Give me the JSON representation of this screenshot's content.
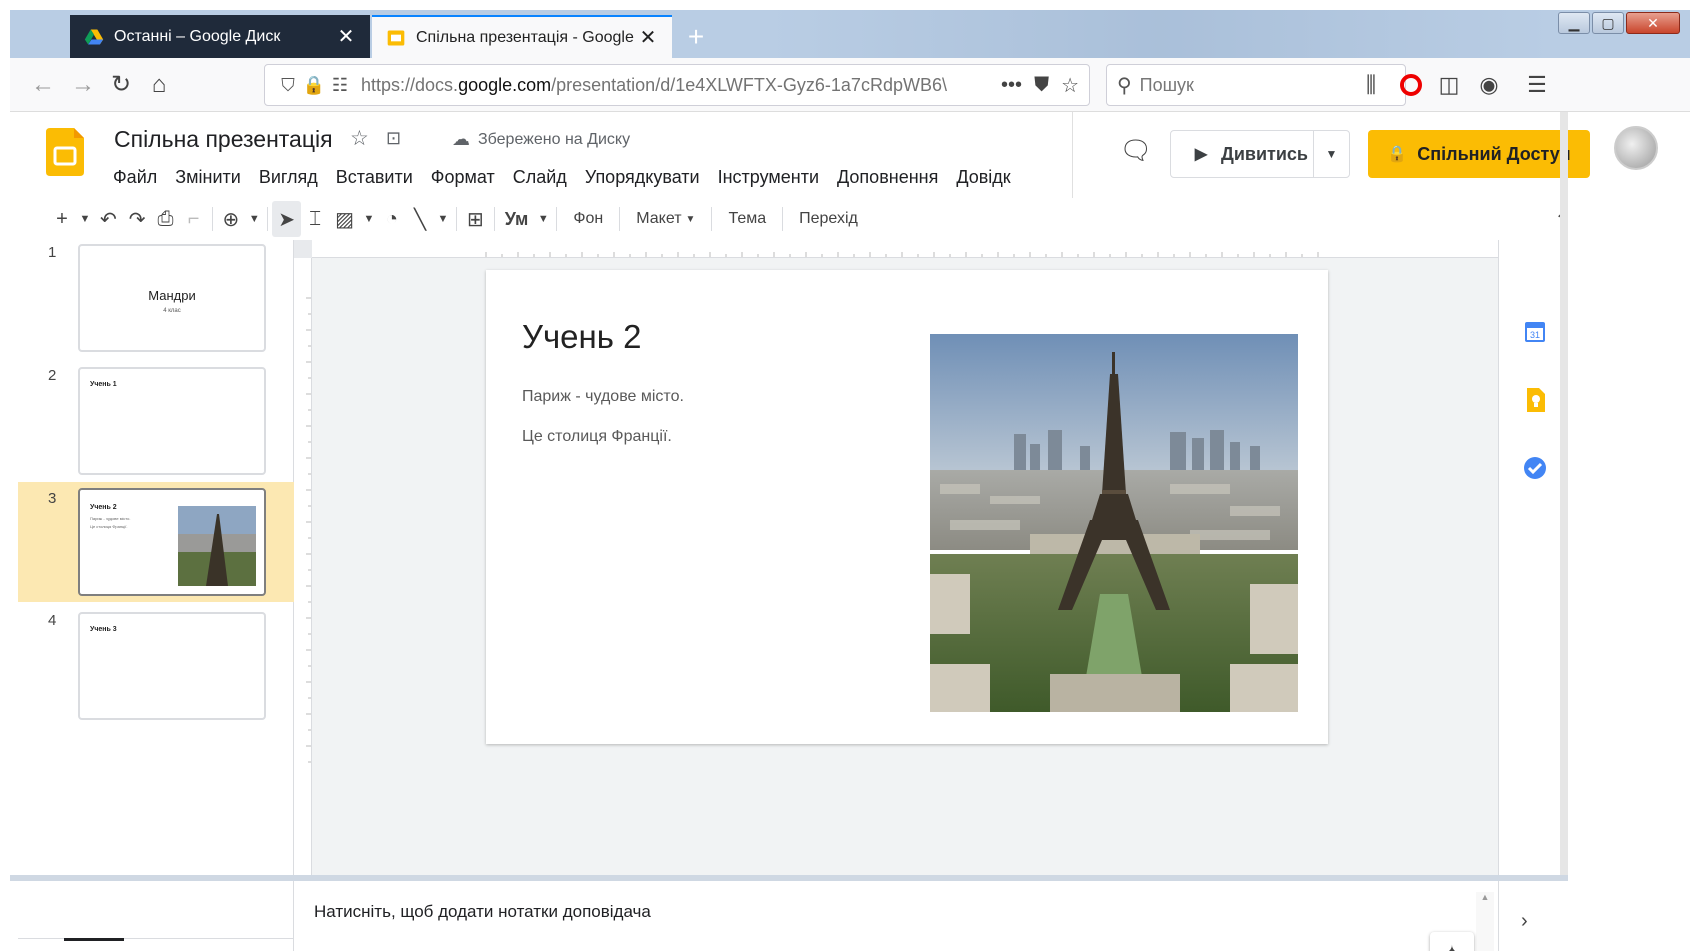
{
  "browser": {
    "tabs": [
      {
        "label": "Останні – Google Диск",
        "active": false
      },
      {
        "label": "Спільна презентація - Google",
        "active": true
      }
    ],
    "url": {
      "prefix": "https://docs.",
      "domain": "google.com",
      "path": "/presentation/d/1e4XLWFTX-Gyz6-1a7cRdpWB6\\"
    },
    "search_placeholder": "Пошук"
  },
  "app": {
    "doc_title": "Спільна презентація",
    "save_status": "Збережено на Диску",
    "menu": [
      "Файл",
      "Змінити",
      "Вигляд",
      "Вставити",
      "Формат",
      "Слайд",
      "Упорядкувати",
      "Інструменти",
      "Доповнення",
      "Довідк"
    ],
    "present_label": "Дивитись",
    "share_label": "Спільний Доступ",
    "brand_color": "#fbbc04",
    "toolbar": {
      "background": "Фон",
      "layout": "Макет",
      "theme": "Тема",
      "transition": "Перехід",
      "text_style": "Ум"
    }
  },
  "filmstrip": [
    {
      "num": "1",
      "title": "Мандри",
      "subtitle": "4 клас"
    },
    {
      "num": "2",
      "title": "Учень 1"
    },
    {
      "num": "3",
      "title": "Учень 2",
      "lines": [
        "Париж - чудове місто.",
        "Це столиця Франції."
      ],
      "selected": true
    },
    {
      "num": "4",
      "title": "Учень 3"
    }
  ],
  "slide": {
    "title": "Учень 2",
    "body": [
      "Париж - чудове місто.",
      "Це столиця Франції."
    ]
  },
  "notes_placeholder": "Натисніть, щоб додати нотатки доповідача",
  "side_panel": {
    "icons": [
      "calendar-icon",
      "keep-icon",
      "tasks-icon"
    ]
  }
}
